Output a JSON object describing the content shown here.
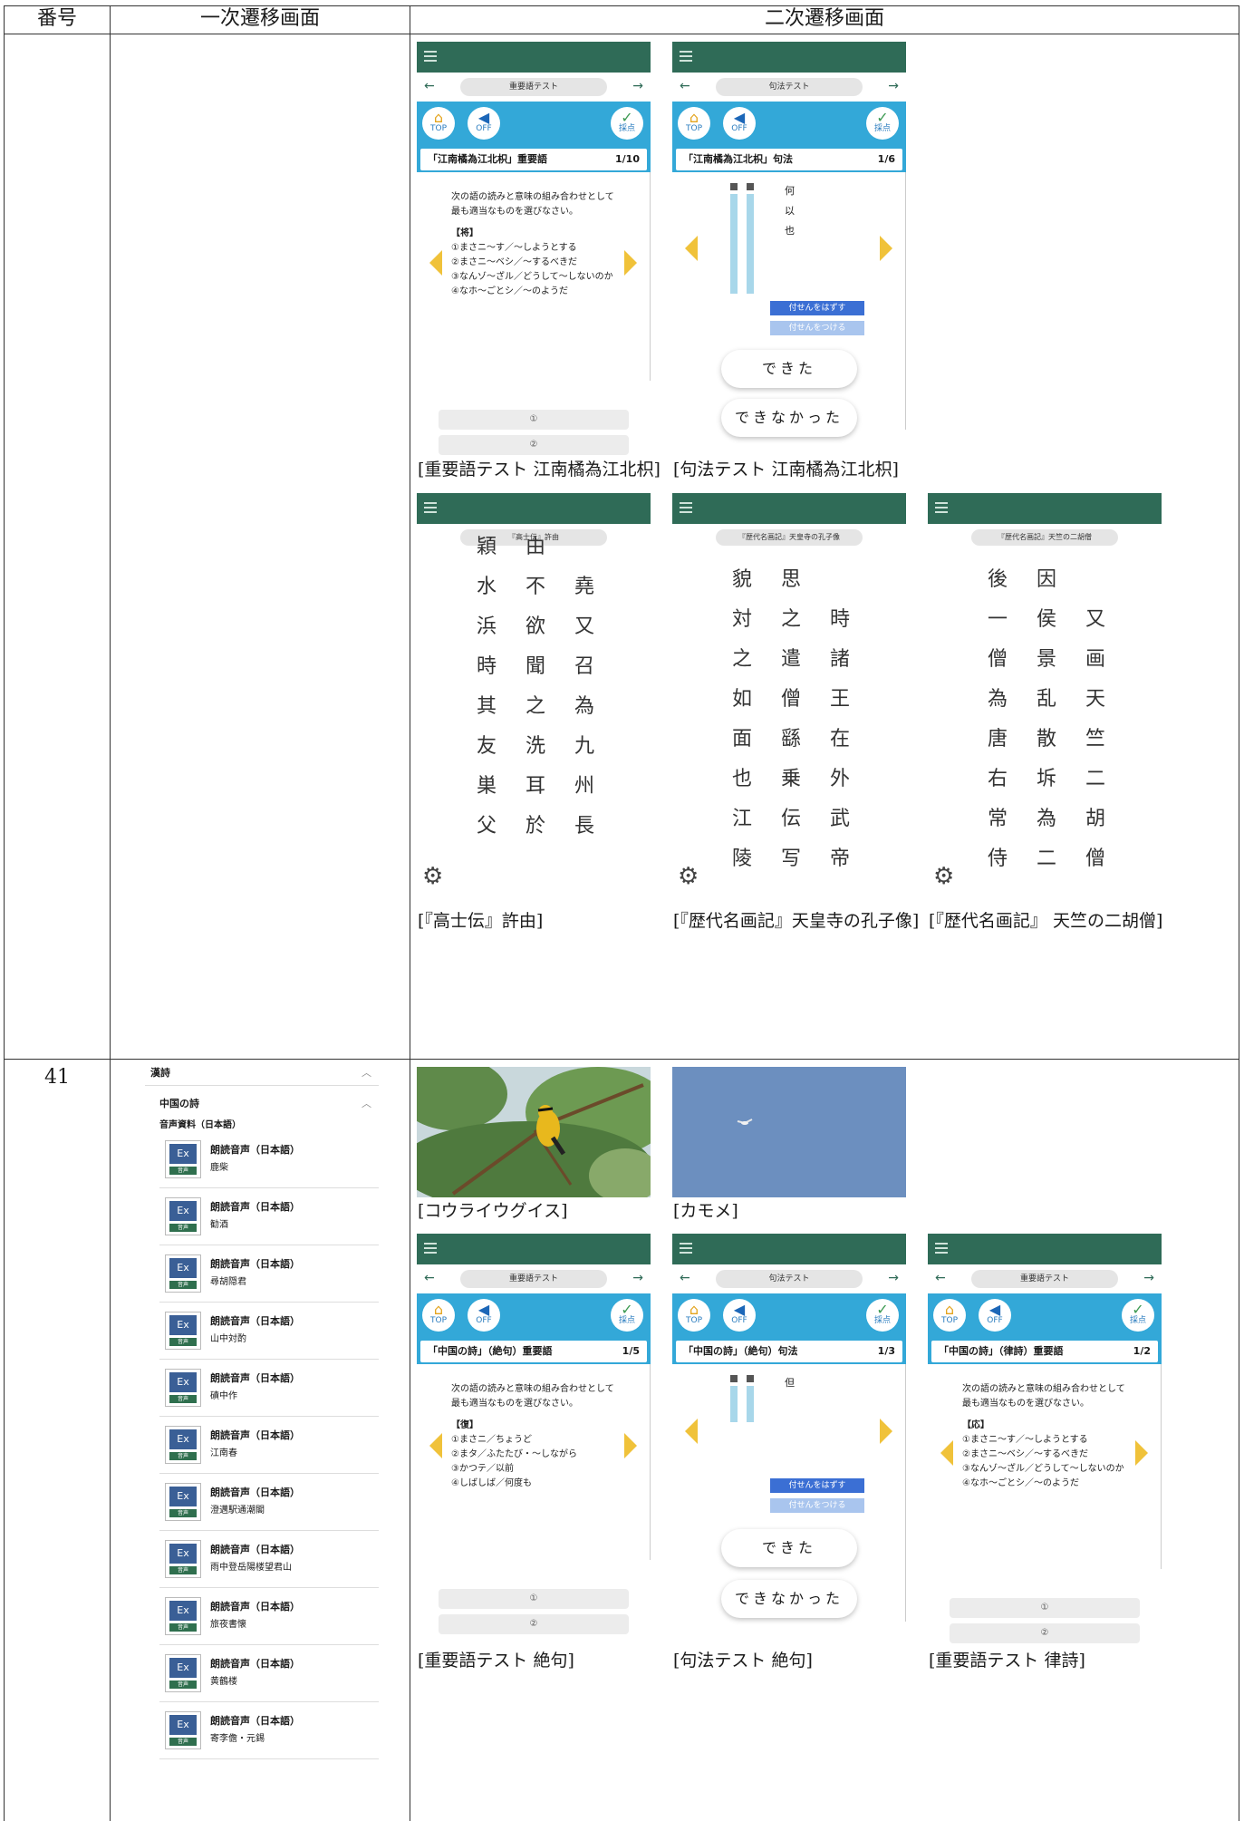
{
  "table": {
    "headers": [
      "番号",
      "一次遷移画面",
      "二次遷移画面"
    ],
    "row2_number": "41"
  },
  "captions": {
    "c1": "[重要語テスト 江南橘為江北枳]",
    "c2": "[句法テスト 江南橘為江北枳]",
    "c3": "[『高士伝』許由]",
    "c4": "[『歴代名画記』天皇寺の孔子像]",
    "c5": "[『歴代名画記』 天竺の二胡僧]",
    "c6": "[コウライウグイス]",
    "c7": "[カモメ]",
    "c8": "[重要語テスト 絶句]",
    "c9": "[句法テスト 絶句]",
    "c10": "[重要語テスト 律詩]"
  },
  "phones": {
    "top_label": "TOP",
    "off_label": "OFF",
    "score_label": "採点",
    "p1": {
      "nav": "重要語テスト",
      "sub": "「江南橘為江北枳」重要語",
      "count": "1/10",
      "q": "次の語の読みと意味の組み合わせとして最も適当なものを選びなさい。",
      "word": "【将】",
      "opts": [
        "①まさニ〜す／〜しようとする",
        "②まさニ〜ベシ／〜するべきだ",
        "③なんゾ〜ざル／どうして〜しないのか",
        "④なホ〜ごとシ／〜のようだ"
      ],
      "a1": "①",
      "a2": "②"
    },
    "p2": {
      "nav": "句法テスト",
      "sub": "「江南橘為江北枳」句法",
      "count": "1/6",
      "k1": "何",
      "k2": "以",
      "k3": "也",
      "b1": "付せんをはずす",
      "b2": "付せんをつける",
      "done": "できた",
      "done2": "できなかった"
    },
    "p8": {
      "nav": "重要語テスト",
      "sub": "「中国の詩」（絶句）重要語",
      "count": "1/5",
      "q": "次の語の読みと意味の組み合わせとして最も適当なものを選びなさい。",
      "word": "【復】",
      "opts": [
        "①まさニ／ちょうど",
        "②まタ／ふたたび・〜しながら",
        "③かつテ／以前",
        "④しばしば／何度も"
      ],
      "a1": "①",
      "a2": "②"
    },
    "p9": {
      "nav": "句法テスト",
      "sub": "「中国の詩」（絶句）句法",
      "count": "1/3",
      "k1": "但",
      "b1": "付せんをはずす",
      "b2": "付せんをつける",
      "done": "できた",
      "done2": "できなかった"
    },
    "p10": {
      "nav": "重要語テスト",
      "sub": "「中国の詩」（律詩）重要語",
      "count": "1/2",
      "q": "次の語の読みと意味の組み合わせとして最も適当なものを選びなさい。",
      "word": "【応】",
      "opts": [
        "①まさニ〜す／〜しようとする",
        "②まさニ〜ベシ／〜するべきだ",
        "③なんゾ〜ざル／どうして〜しないのか",
        "④なホ〜ごとシ／〜のようだ"
      ],
      "a1": "①",
      "a2": "②"
    }
  },
  "vertical": {
    "v1": {
      "nav": "『高士伝』許由",
      "cols": [
        [
          "由"
        ],
        [
          "穎",
          "水",
          "浜",
          "時",
          "其",
          "友",
          "巣",
          "父"
        ],
        [
          "堯",
          "又",
          "召",
          "為",
          "九",
          "州",
          "長"
        ],
        [
          "不",
          "欲",
          "聞",
          "之",
          "洗",
          "耳",
          "於"
        ]
      ]
    },
    "v2": {
      "nav": "『歴代名画記』天皇寺の孔子像",
      "c1": [
        "時",
        "諸",
        "王",
        "在",
        "外",
        "武",
        "帝"
      ],
      "c2": [
        "思",
        "之",
        "遣",
        "僧",
        "繇",
        "乗",
        "伝",
        "写"
      ],
      "c3": [
        "貌",
        "対",
        "之",
        "如",
        "面",
        "也",
        "江",
        "陵"
      ]
    },
    "v3": {
      "nav": "『歴代名画記』天竺の二胡僧",
      "c1": [
        "又",
        "画",
        "天",
        "竺",
        "二",
        "胡",
        "僧"
      ],
      "c2": [
        "因",
        "侯",
        "景",
        "乱",
        "散",
        "坼",
        "為",
        "二"
      ],
      "c3": [
        "後",
        "一",
        "僧",
        "為",
        "唐",
        "右",
        "常",
        "侍"
      ]
    }
  },
  "library": {
    "h1": "漢詩",
    "h2": "中国の詩",
    "h3": "音声資料（日本語）",
    "item_title": "朗読音声（日本語）",
    "ex_label": "Ex",
    "on_label": "音声",
    "items": [
      "鹿柴",
      "勧酒",
      "尋胡隠君",
      "山中対酌",
      "磧中作",
      "江南春",
      "澄邁駅通潮閣",
      "雨中登岳陽楼望君山",
      "旅夜書懐",
      "黄鶴楼",
      "寄李儋・元錫"
    ]
  }
}
